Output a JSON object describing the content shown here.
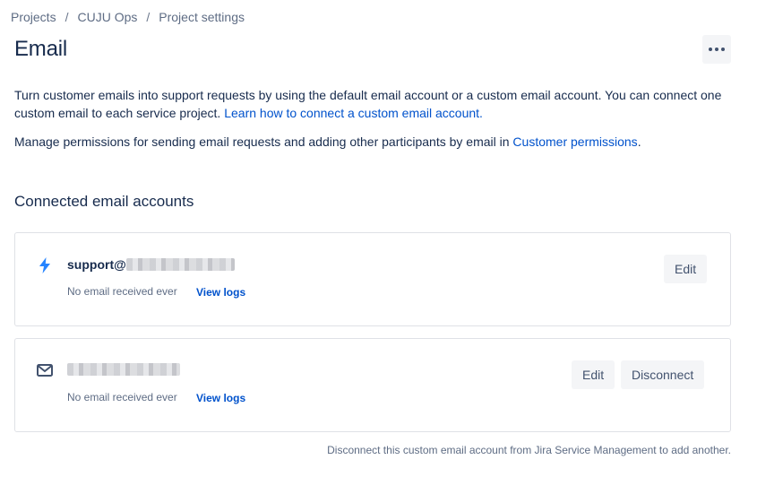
{
  "breadcrumb": {
    "items": [
      "Projects",
      "CUJU Ops",
      "Project settings"
    ],
    "separator": "/"
  },
  "page": {
    "title": "Email",
    "more_icon": "more-horizontal-icon"
  },
  "intro": {
    "paragraph1_text": "Turn customer emails into support requests by using the default email account or a custom email account. You can connect one custom email to each service project. ",
    "paragraph1_link": "Learn how to connect a custom email account.",
    "paragraph2_text": "Manage permissions for sending email requests and adding other participants by email in ",
    "paragraph2_link": "Customer permissions",
    "paragraph2_end": "."
  },
  "section": {
    "heading": "Connected email accounts"
  },
  "accounts": [
    {
      "icon": "lightning-bolt-icon",
      "address_prefix": "support@",
      "status": "No email received ever",
      "logs_label": "View logs",
      "edit_label": "Edit"
    },
    {
      "icon": "envelope-icon",
      "address_prefix": "",
      "status": "No email received ever",
      "logs_label": "View logs",
      "edit_label": "Edit",
      "disconnect_label": "Disconnect"
    }
  ],
  "footnote": "Disconnect this custom email account from Jira Service Management to add another.",
  "colors": {
    "link": "#0052cc",
    "text": "#172b4d",
    "subtle": "#5e6c84",
    "bolt": "#2684ff",
    "button_bg": "#f4f5f7"
  }
}
